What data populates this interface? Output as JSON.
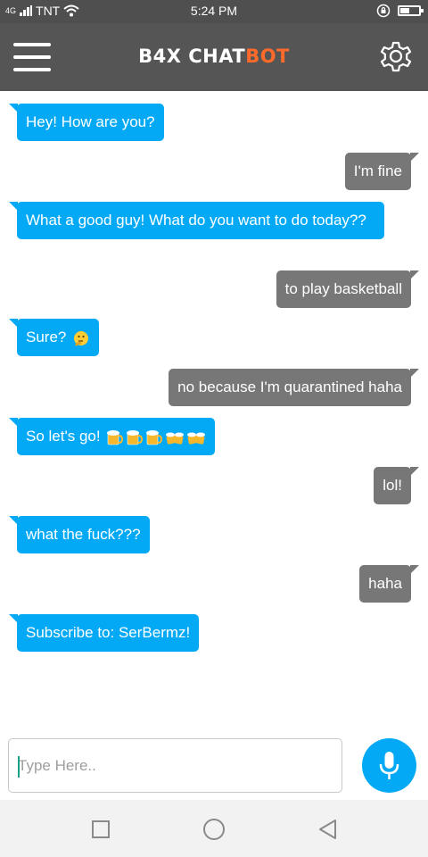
{
  "status_bar": {
    "carrier": "TNT",
    "network_label": "4G",
    "time": "5:24 PM"
  },
  "app_bar": {
    "title_main": "B4X CHAT",
    "title_accent": "BOT",
    "accent_color": "#ff6a2b",
    "menu_icon": "hamburger-menu-icon",
    "settings_icon": "gear-icon"
  },
  "chat": {
    "messages": [
      {
        "from": "bot",
        "text": "Hey! How are you?"
      },
      {
        "from": "user",
        "text": "I'm fine"
      },
      {
        "from": "bot",
        "text": "What a good guy! What do you want to do today??"
      },
      {
        "from": "user",
        "text": "to play basketball"
      },
      {
        "from": "bot",
        "text": "Sure?",
        "emoji": "thinking-face"
      },
      {
        "from": "user",
        "text": "no because I'm quarantined haha"
      },
      {
        "from": "bot",
        "text": "So let's go!",
        "emoji": "beer-mugs"
      },
      {
        "from": "user",
        "text": "lol!"
      },
      {
        "from": "bot",
        "text": "what the fuck???"
      },
      {
        "from": "user",
        "text": "haha"
      },
      {
        "from": "bot",
        "text": "Subscribe to: SerBermz!"
      }
    ],
    "bot_color": "#03a9f4",
    "user_color": "#777777"
  },
  "composer": {
    "placeholder": "Type Here..",
    "value": "",
    "mic_icon": "microphone-icon"
  },
  "nav_bar": {
    "recent_icon": "square-recents-icon",
    "home_icon": "circle-home-icon",
    "back_icon": "triangle-back-icon"
  }
}
